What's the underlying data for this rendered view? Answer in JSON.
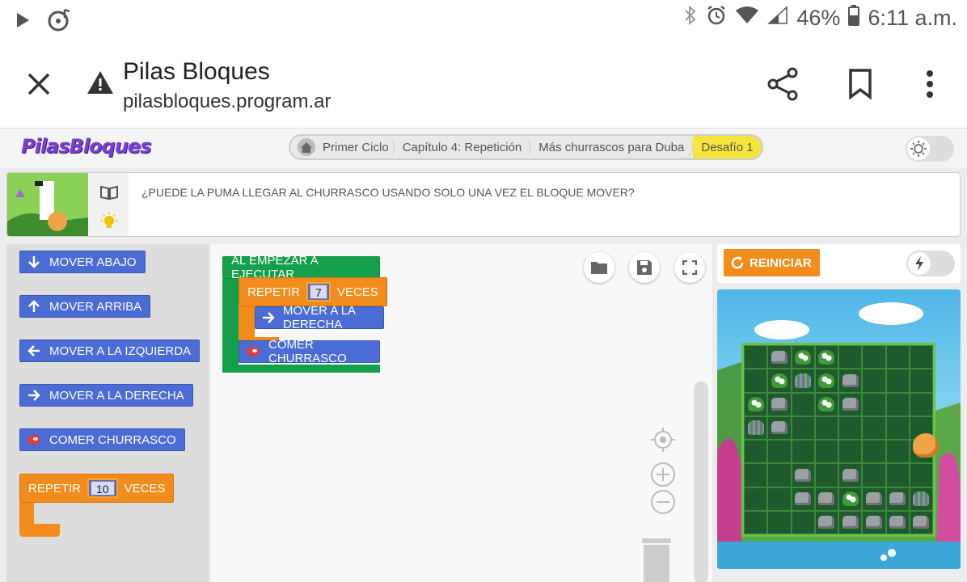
{
  "status_bar": {
    "battery": "46%",
    "time": "6:11 a.m."
  },
  "browser": {
    "page_title": "Pilas Bloques",
    "url": "pilasbloques.program.ar"
  },
  "header": {
    "logo_text": "PilasBloques",
    "breadcrumbs": [
      "Primer Ciclo",
      "Capítulo 4: Repetición",
      "Más churrascos para Duba",
      "Desafío 1"
    ]
  },
  "challenge": {
    "question": "¿PUEDE LA PUMA LLEGAR AL CHURRASCO USANDO SOLO UNA VEZ EL BLOQUE MOVER?"
  },
  "palette": {
    "blocks": [
      {
        "label": "MOVER ABAJO",
        "icon": "arrow-down-icon"
      },
      {
        "label": "MOVER ARRIBA",
        "icon": "arrow-up-icon"
      },
      {
        "label": "MOVER A LA IZQUIERDA",
        "icon": "arrow-left-icon"
      },
      {
        "label": "MOVER A LA DERECHA",
        "icon": "arrow-right-icon"
      },
      {
        "label": "COMER CHURRASCO",
        "icon": "steak-icon"
      }
    ],
    "repeat_block": {
      "label": "REPETIR",
      "count": "10",
      "suffix": "VECES"
    }
  },
  "workspace": {
    "start_block": "AL EMPEZAR A EJECUTAR",
    "repeat_label": "REPETIR",
    "repeat_count": "7",
    "repeat_suffix": "VECES",
    "inner_block": "MOVER A LA DERECHA",
    "after_block": "COMER CHURRASCO"
  },
  "stage": {
    "restart_label": "REINICIAR",
    "grid_rows": [
      [
        "",
        "rock",
        "plant",
        "plant",
        "",
        "",
        "",
        ""
      ],
      [
        "",
        "plant",
        "lavender",
        "plant",
        "rock",
        "",
        "",
        ""
      ],
      [
        "plant",
        "rock",
        "",
        "plant",
        "rock",
        "",
        "",
        ""
      ],
      [
        "lavender",
        "rock",
        "",
        "",
        "",
        "",
        "",
        ""
      ],
      [
        "",
        "",
        "",
        "",
        "",
        "",
        "",
        ""
      ],
      [
        "",
        "",
        "rock",
        "",
        "rock",
        "",
        "",
        ""
      ],
      [
        "",
        "",
        "rock",
        "rock",
        "plant",
        "rock",
        "rock",
        "lavender"
      ],
      [
        "",
        "",
        "",
        "rock",
        "rock",
        "rock",
        "rock",
        "rock"
      ]
    ]
  },
  "colors": {
    "motion_block": "#4a6cd4",
    "control_block": "#f28c1c",
    "event_block": "#14a04a",
    "active_crumb": "#f6e63c"
  }
}
